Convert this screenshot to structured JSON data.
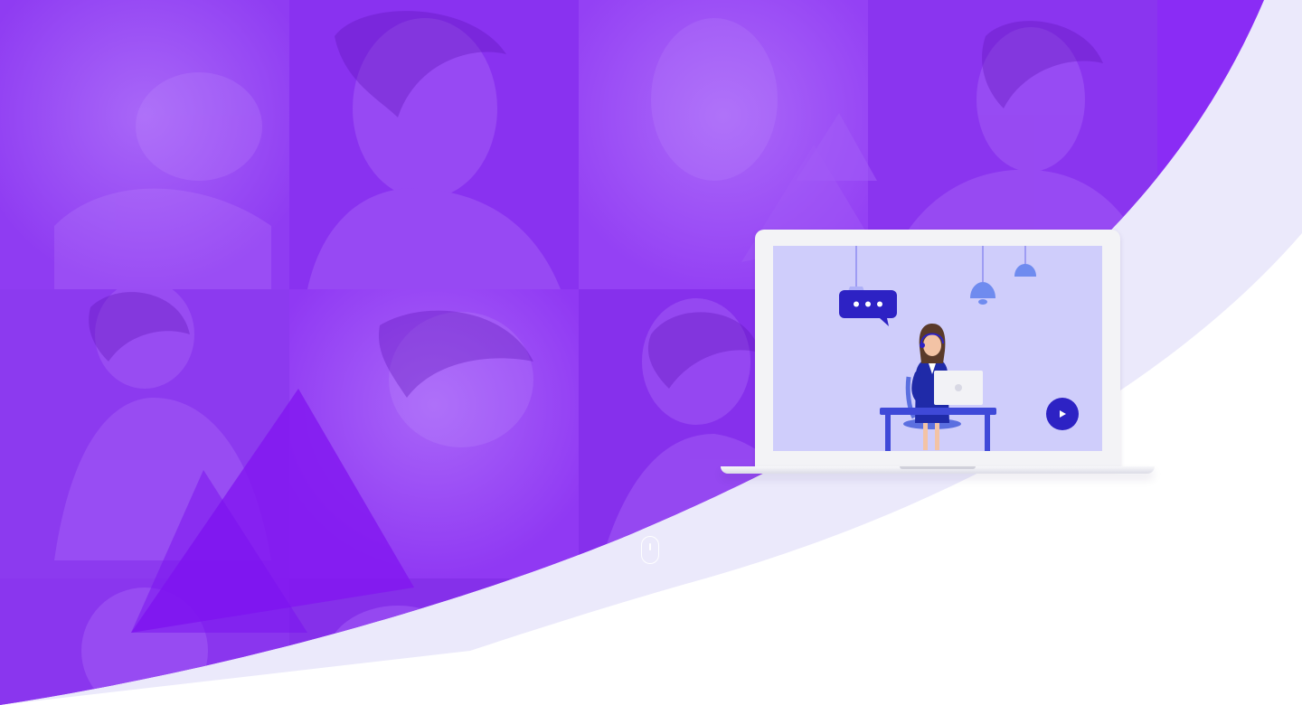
{
  "hero": {
    "photo_tiles": [
      {
        "subject": "woman-resting-on-pillow"
      },
      {
        "subject": "young-man-hand-on-chin"
      },
      {
        "subject": "blonde-woman"
      },
      {
        "subject": "young-man-side-profile"
      },
      {
        "subject": "young-man-necklace"
      },
      {
        "subject": "short-haired-woman"
      },
      {
        "subject": "young-man-patterned-shirt"
      },
      {
        "subject": "woman-profile"
      },
      {
        "subject": "man-looking-down"
      }
    ],
    "overlay_color": "#8a2cf5",
    "curve_color": "#ebe9fb",
    "triangle_color": "#8216f0"
  },
  "video_card": {
    "screen_color": "#cfcdfb",
    "illustration": "customer-support-agent-at-desk-with-laptop",
    "chat_bubble_icon": "chat-bubble-icon",
    "play_icon": "play-icon",
    "accent": "#2d22c4"
  },
  "scroll_indicator": {
    "icon": "mouse-scroll-icon"
  }
}
